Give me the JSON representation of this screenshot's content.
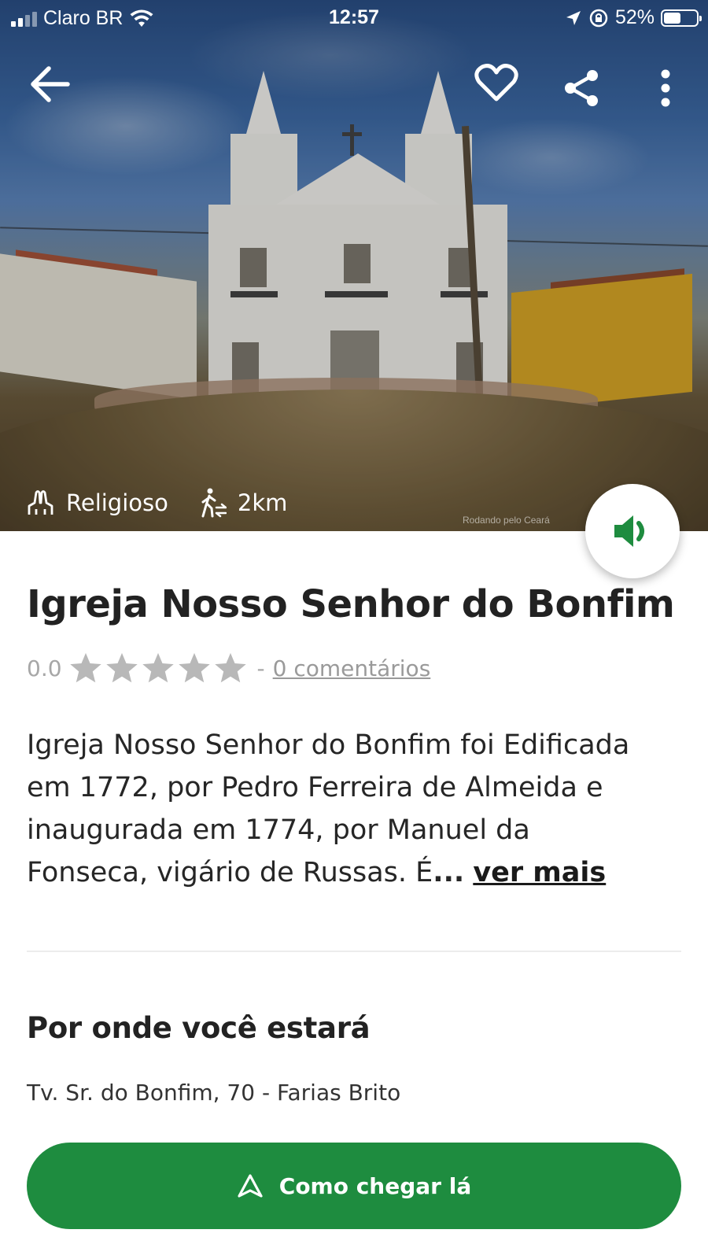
{
  "status_bar": {
    "carrier": "Claro BR",
    "time": "12:57",
    "battery": "52%",
    "battery_level": 0.52
  },
  "header": {
    "icons": [
      "back-arrow-icon",
      "heart-icon",
      "share-icon",
      "more-vertical-icon"
    ]
  },
  "hero": {
    "category": "Religioso",
    "distance": "2km",
    "photo_credit": "Rodando pelo Ceará"
  },
  "place": {
    "title": "Igreja Nosso Senhor do Bonfim",
    "rating_value": "0.0",
    "rating_stars_filled": 0,
    "rating_stars_total": 5,
    "rating_separator": "-",
    "comments_link": "0 comentários",
    "description_lines": [
      "Igreja Nosso Senhor do Bonfim foi Edificada",
      "em 1772, por Pedro Ferreira de Almeida e",
      "inaugurada em 1774, por Manuel da",
      "Fonseca, vigário de Russas. É"
    ],
    "description_ellipsis": "...",
    "see_more": "ver mais"
  },
  "location": {
    "section_title": "Por onde você estará",
    "address": "Tv. Sr. do Bonfim, 70 - Farias Brito",
    "directions_button": "Como chegar lá"
  },
  "colors": {
    "primary_green": "#1e8c3f",
    "star_gray": "#b8b8b8",
    "text_dark": "#222222"
  }
}
